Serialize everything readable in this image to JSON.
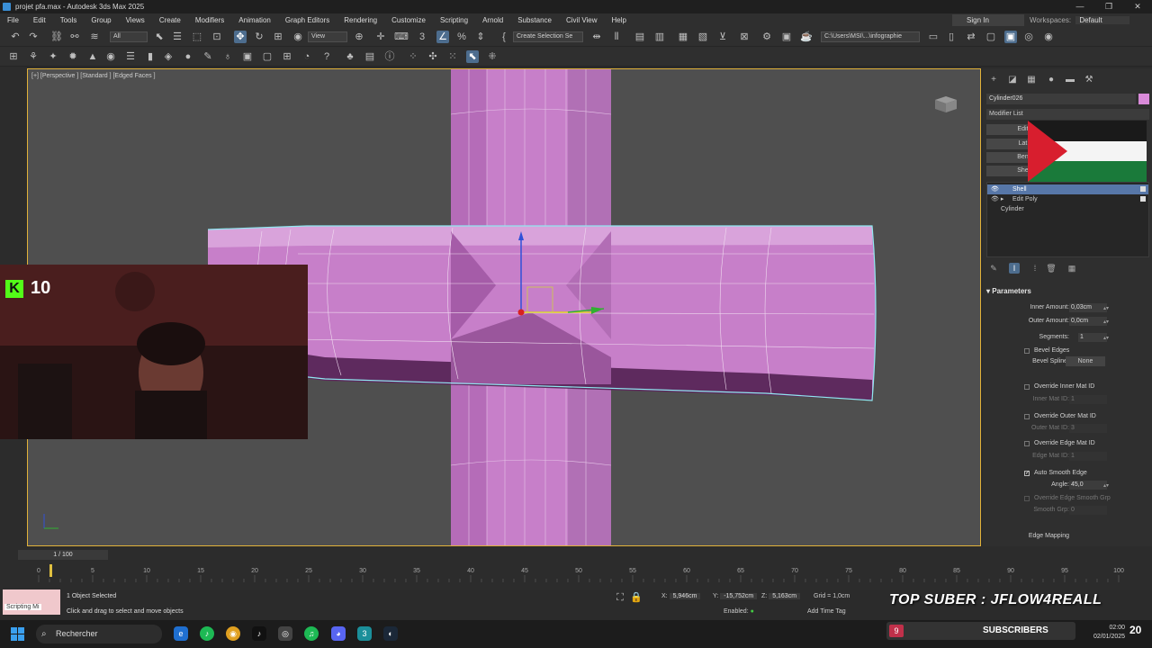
{
  "window": {
    "title": "projet pfa.max - Autodesk 3ds Max 2025",
    "controls": [
      "—",
      "❐",
      "✕"
    ]
  },
  "menu": {
    "items": [
      "File",
      "Edit",
      "Tools",
      "Group",
      "Views",
      "Create",
      "Modifiers",
      "Animation",
      "Graph Editors",
      "Rendering",
      "Customize",
      "Scripting",
      "Arnold",
      "Substance",
      "Civil View",
      "Help"
    ],
    "sign_in": "Sign In",
    "workspaces_label": "Workspaces:",
    "workspaces_value": "Default"
  },
  "toolbar": {
    "filter_dropdown": "All",
    "view_dropdown": "View",
    "create_selection_set": "Create Selection Se",
    "path_dropdown": "C:\\Users\\MSI\\...\\infographie"
  },
  "viewport": {
    "label": "[+] [Perspective ] [Standard ] [Edged Faces ]",
    "object_color": "#c77fc9",
    "selection_color": "#8fe8f0"
  },
  "stream": {
    "kick_letter": "K",
    "viewer_count": "10",
    "top_suber": "TOP SUBER : JFLOW4REALL",
    "subscribers_label": "SUBSCRIBERS",
    "subscribers_count_badge": "9",
    "subscribers_total": "20"
  },
  "command_panel": {
    "object_name": "Cylinder026",
    "modifier_list": "Modifier List",
    "mod_buttons": [
      "Edit",
      "Lat",
      "Ben",
      "She"
    ],
    "stack": [
      {
        "label": "Shell",
        "selected": true
      },
      {
        "label": "Edit Poly",
        "selected": false
      },
      {
        "label": "Cylinder",
        "selected": false
      }
    ],
    "params_title": "Parameters",
    "params": {
      "inner_amount_label": "Inner Amount:",
      "inner_amount": "0,03cm",
      "outer_amount_label": "Outer Amount:",
      "outer_amount": "0,0cm",
      "segments_label": "Segments:",
      "segments": "1",
      "bevel_edges": "Bevel Edges",
      "bevel_spline_label": "Bevel Spline:",
      "bevel_spline": "None",
      "override_inner": "Override Inner Mat ID",
      "inner_mat_label": "Inner Mat ID:",
      "inner_mat": "1",
      "override_outer": "Override Outer Mat ID",
      "outer_mat_label": "Outer Mat ID:",
      "outer_mat": "3",
      "override_edge": "Override Edge Mat ID",
      "edge_mat_label": "Edge Mat ID:",
      "edge_mat": "1",
      "auto_smooth": "Auto Smooth Edge",
      "angle_label": "Angle:",
      "angle": "45,0",
      "override_edge_smooth": "Override Edge Smooth Grp",
      "smooth_grp_label": "Smooth Grp:",
      "smooth_grp": "0",
      "edge_mapping": "Edge Mapping"
    }
  },
  "timeline": {
    "frame_display": "1 / 100",
    "ticks": [
      "0",
      "5",
      "10",
      "15",
      "20",
      "25",
      "30",
      "35",
      "40",
      "45",
      "50",
      "55",
      "60",
      "65",
      "70",
      "75",
      "80",
      "85",
      "90",
      "95",
      "100"
    ],
    "current_frame": 1
  },
  "status": {
    "script_label": "Scripting Mi",
    "selected": "1 Object Selected",
    "hint": "Click and drag to select and move objects",
    "x_label": "X:",
    "x": "5,946cm",
    "y_label": "Y:",
    "y": "-15,752cm",
    "z_label": "Z:",
    "z": "5,163cm",
    "grid": "Grid = 1,0cm",
    "enabled": "Enabled:",
    "add_time_tag": "Add Time Tag"
  },
  "taskbar": {
    "search": "Rechercher",
    "time": "02:00",
    "date": "02/01/2025"
  }
}
